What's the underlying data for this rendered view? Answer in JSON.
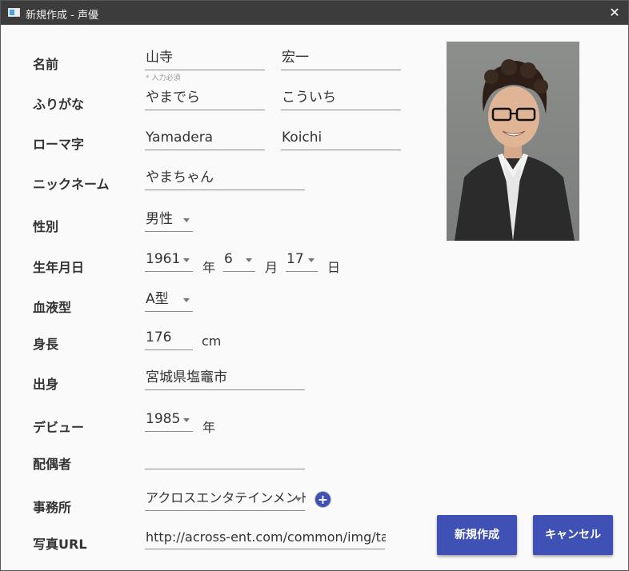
{
  "window": {
    "title": "新規作成 - 声優",
    "close_symbol": "✕"
  },
  "form": {
    "name": {
      "label": "名前",
      "last": "山寺",
      "first": "宏一",
      "hint": "* 入力必須"
    },
    "furigana": {
      "label": "ふりがな",
      "last": "やまでら",
      "first": "こういち"
    },
    "romaji": {
      "label": "ローマ字",
      "last": "Yamadera",
      "first": "Koichi"
    },
    "nickname": {
      "label": "ニックネーム",
      "value": "やまちゃん"
    },
    "gender": {
      "label": "性別",
      "value": "男性"
    },
    "birthday": {
      "label": "生年月日",
      "year": "1961",
      "year_unit": "年",
      "month": "6",
      "month_unit": "月",
      "day": "17",
      "day_unit": "日"
    },
    "blood_type": {
      "label": "血液型",
      "value": "A型"
    },
    "height": {
      "label": "身長",
      "value": "176",
      "unit": "cm"
    },
    "hometown": {
      "label": "出身",
      "value": "宮城県塩竈市"
    },
    "debut": {
      "label": "デビュー",
      "value": "1985",
      "unit": "年"
    },
    "spouse": {
      "label": "配偶者",
      "value": ""
    },
    "agency": {
      "label": "事務所",
      "value": "アクロスエンタテインメント",
      "add_symbol": "+"
    },
    "photo_url": {
      "label": "写真URL",
      "value": "http://across-ent.com/common/img/talent/yamadera_koichi.jpg"
    }
  },
  "buttons": {
    "create": "新規作成",
    "cancel": "キャンセル"
  },
  "icons": {
    "app": "app-window-icon",
    "close": "close-icon",
    "add": "plus-circle-icon",
    "dropdown": "caret-down-icon"
  },
  "colors": {
    "accent": "#3f51b5",
    "titlebar": "#3c3c3c"
  }
}
